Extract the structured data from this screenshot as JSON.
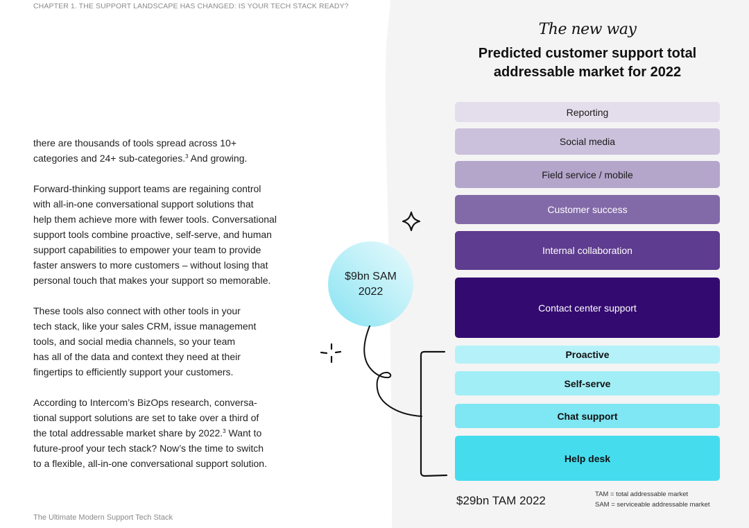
{
  "page": {
    "chapter_header": "Chapter 1. The support landscape has changed: is your tech stack ready?",
    "footer": "The Ultimate Modern Support Tech Stack"
  },
  "body_copy": {
    "paragraphs": [
      {
        "lines": [
          "there are thousands of tools spread across 10+",
          "categories and 24+ sub-categories.",
          " And growing."
        ],
        "footnote": "3"
      },
      {
        "lines": [
          "Forward-thinking support teams are regaining control",
          "with all-in-one conversational support solutions that",
          "help them achieve more with fewer tools. Conversational",
          "support tools combine proactive, self-serve, and human",
          "support capabilities to empower your team to provide",
          "faster answers to more customers – without losing that",
          "personal touch that makes your support so memorable."
        ]
      },
      {
        "lines": [
          "These tools also connect with other tools in your",
          "tech stack, like your sales CRM, issue management",
          "tools, and social media channels, so your team",
          "has all of the data and context they need at their",
          "fingertips to efficiently support your customers."
        ]
      },
      {
        "lines": [
          "According to Intercom’s BizOps research, conversa-",
          "tional support solutions are set to take over a third of",
          "the total addressable market share by 2022.",
          " Want to",
          "future-proof your tech stack? Now’s the time to switch",
          "to a flexible, all-in-one conversational support solution."
        ],
        "footnote": "3"
      }
    ]
  },
  "infographic": {
    "script_title": "The new way",
    "title_line1": "Predicted customer support total",
    "title_line2": "addressable market for 2022",
    "segments": [
      {
        "label": "Reporting",
        "bg": "#e4deec",
        "fg": "#1a1a1a",
        "bold": false,
        "group": "TAM"
      },
      {
        "label": "Social media",
        "bg": "#cbc1dc",
        "fg": "#1a1a1a",
        "bold": false,
        "group": "TAM"
      },
      {
        "label": "Field service / mobile",
        "bg": "#b4a5cb",
        "fg": "#1a1a1a",
        "bold": false,
        "group": "TAM"
      },
      {
        "label": "Customer success",
        "bg": "#826aa8",
        "fg": "#ffffff",
        "bold": false,
        "group": "TAM"
      },
      {
        "label": "Internal collaboration",
        "bg": "#5e3c8f",
        "fg": "#ffffff",
        "bold": false,
        "group": "TAM"
      },
      {
        "label": "Contact center support",
        "bg": "#330b70",
        "fg": "#ffffff",
        "bold": false,
        "group": "TAM"
      },
      {
        "label": "Proactive",
        "bg": "#b5f1f8",
        "fg": "#111111",
        "bold": true,
        "group": "SAM"
      },
      {
        "label": "Self-serve",
        "bg": "#a1eef6",
        "fg": "#111111",
        "bold": true,
        "group": "SAM"
      },
      {
        "label": "Chat support",
        "bg": "#7fe6f3",
        "fg": "#111111",
        "bold": true,
        "group": "SAM"
      },
      {
        "label": "Help desk",
        "bg": "#45ddee",
        "fg": "#111111",
        "bold": true,
        "group": "SAM"
      }
    ],
    "sam_bubble": {
      "line1": "$9bn SAM",
      "line2": "2022"
    },
    "tam_total": "$29bn TAM 2022",
    "legend": [
      "TAM = total addressable market",
      "SAM = serviceable addressable market"
    ],
    "colors": {
      "panel_bg": "#f4f4f4",
      "page_bg": "#ffffff",
      "ink": "#111111"
    }
  }
}
